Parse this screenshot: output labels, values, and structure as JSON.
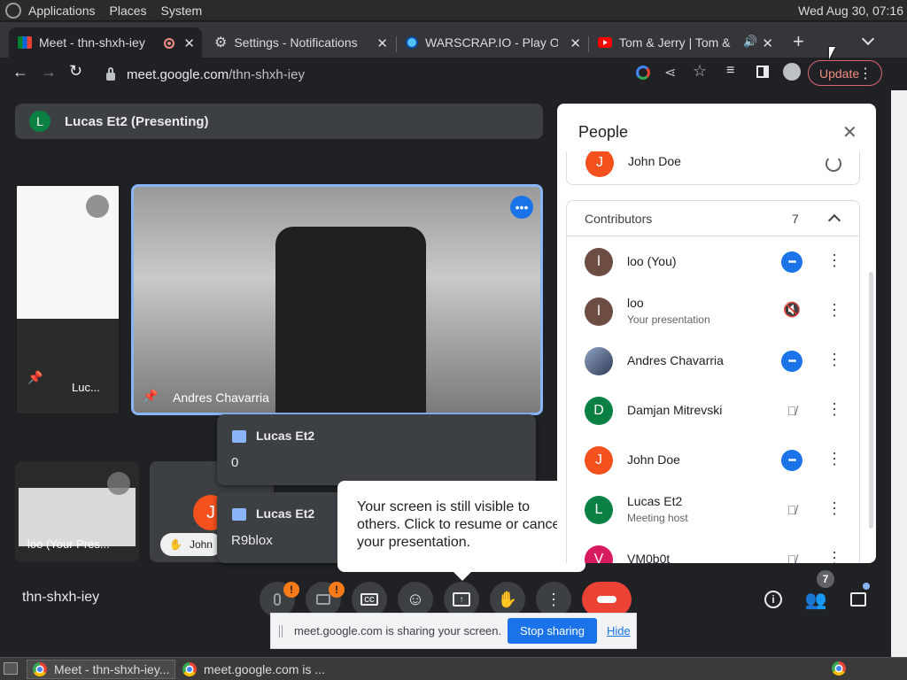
{
  "system_bar": {
    "menus": [
      "Applications",
      "Places",
      "System"
    ],
    "clock": "Wed Aug 30, 07:16"
  },
  "tabs": [
    {
      "label": "Meet - thn-shxh-iey",
      "icon": "meet-icon",
      "active": true
    },
    {
      "label": "Settings - Notifications",
      "icon": "gear-icon",
      "active": false
    },
    {
      "label": "WARSCRAP.IO - Play Onl",
      "icon": "globe-icon",
      "active": false
    },
    {
      "label": "Tom & Jerry | Tom & Je",
      "icon": "youtube-icon",
      "active": false
    }
  ],
  "toolbar": {
    "url_host": "meet.google.com",
    "url_path": "/thn-shxh-iey",
    "update_label": "Update"
  },
  "presenting_bar": {
    "avatar_letter": "L",
    "text": "Lucas Et2 (Presenting)"
  },
  "tiles": {
    "main_name": "Andres Chavarria",
    "thumb1_name": "Luc...",
    "thumb2_name": "loo (Your Pres...",
    "thumb3_avatar": "J",
    "thumb3_name": "John"
  },
  "chat_popups": [
    {
      "sender": "Lucas Et2",
      "message": "0"
    },
    {
      "sender": "Lucas Et2",
      "message": "R9blox"
    }
  ],
  "tooltip": {
    "text": "Your screen is still visible to others. Click to resume or cancel your presentation."
  },
  "meeting": {
    "code": "thn-shxh-iey",
    "people_count": "7"
  },
  "people_panel": {
    "title": "People",
    "partial_top_row": {
      "name": "John Doe",
      "letter": "J",
      "color": "#f4511e"
    },
    "section_title": "Contributors",
    "section_count": "7",
    "rows": [
      {
        "letter": "l",
        "name": "loo (You)",
        "sub": "",
        "color": "#6d4c41",
        "action": "more"
      },
      {
        "letter": "l",
        "name": "loo",
        "sub": "Your presentation",
        "color": "#6d4c41",
        "action": "volume-off"
      },
      {
        "letter": "",
        "name": "Andres Chavarria",
        "sub": "",
        "color": "#4a5b7a",
        "action": "more"
      },
      {
        "letter": "D",
        "name": "Damjan Mitrevski",
        "sub": "",
        "color": "#0b8043",
        "action": "mic-off"
      },
      {
        "letter": "J",
        "name": "John Doe",
        "sub": "",
        "color": "#f4511e",
        "action": "more"
      },
      {
        "letter": "L",
        "name": "Lucas Et2",
        "sub": "Meeting host",
        "color": "#0b8043",
        "action": "mic-off"
      },
      {
        "letter": "V",
        "name": "VM0b0t",
        "sub": "",
        "color": "#d81b60",
        "action": "mic-off"
      }
    ]
  },
  "share_bar": {
    "text": "meet.google.com is sharing your screen.",
    "stop_label": "Stop sharing",
    "hide_label": "Hide"
  },
  "taskbar": {
    "items": [
      "Meet - thn-shxh-iey...",
      "meet.google.com is ..."
    ]
  },
  "colors": {
    "accent": "#1a73e8",
    "end_call": "#ea4335",
    "warning": "#fa7b17"
  }
}
